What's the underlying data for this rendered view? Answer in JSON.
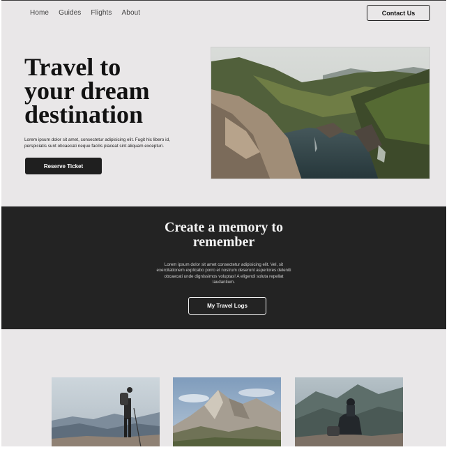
{
  "nav": {
    "links": [
      "Home",
      "Guides",
      "Flights",
      "About"
    ],
    "contact_label": "Contact Us"
  },
  "hero": {
    "title_lines": [
      "Travel to",
      "your dream",
      "destination"
    ],
    "description": "Lorem ipsum dolor sit amet, consectetur adipisicing elit. Fugit hic libero id, perspiciatis sunt obcaecati neque facilis placeat sint aliquam excepturi.",
    "cta_label": "Reserve Ticket"
  },
  "memory": {
    "title_lines": [
      "Create a memory to",
      "remember"
    ],
    "description": "Lorem ipsum dolor sit amet consectetur adipisicing elit. Vel, sit exercitationem explicabo porro et nostrum deserunt asperiores deleniti obcaecati unde dignissimos voluptas! A eligendi soluta repellat laudantium.",
    "cta_label": "My Travel Logs"
  },
  "colors": {
    "page_bg": "#e9e7e8",
    "dark_band": "#232323",
    "primary_button": "#1f1f1f"
  }
}
